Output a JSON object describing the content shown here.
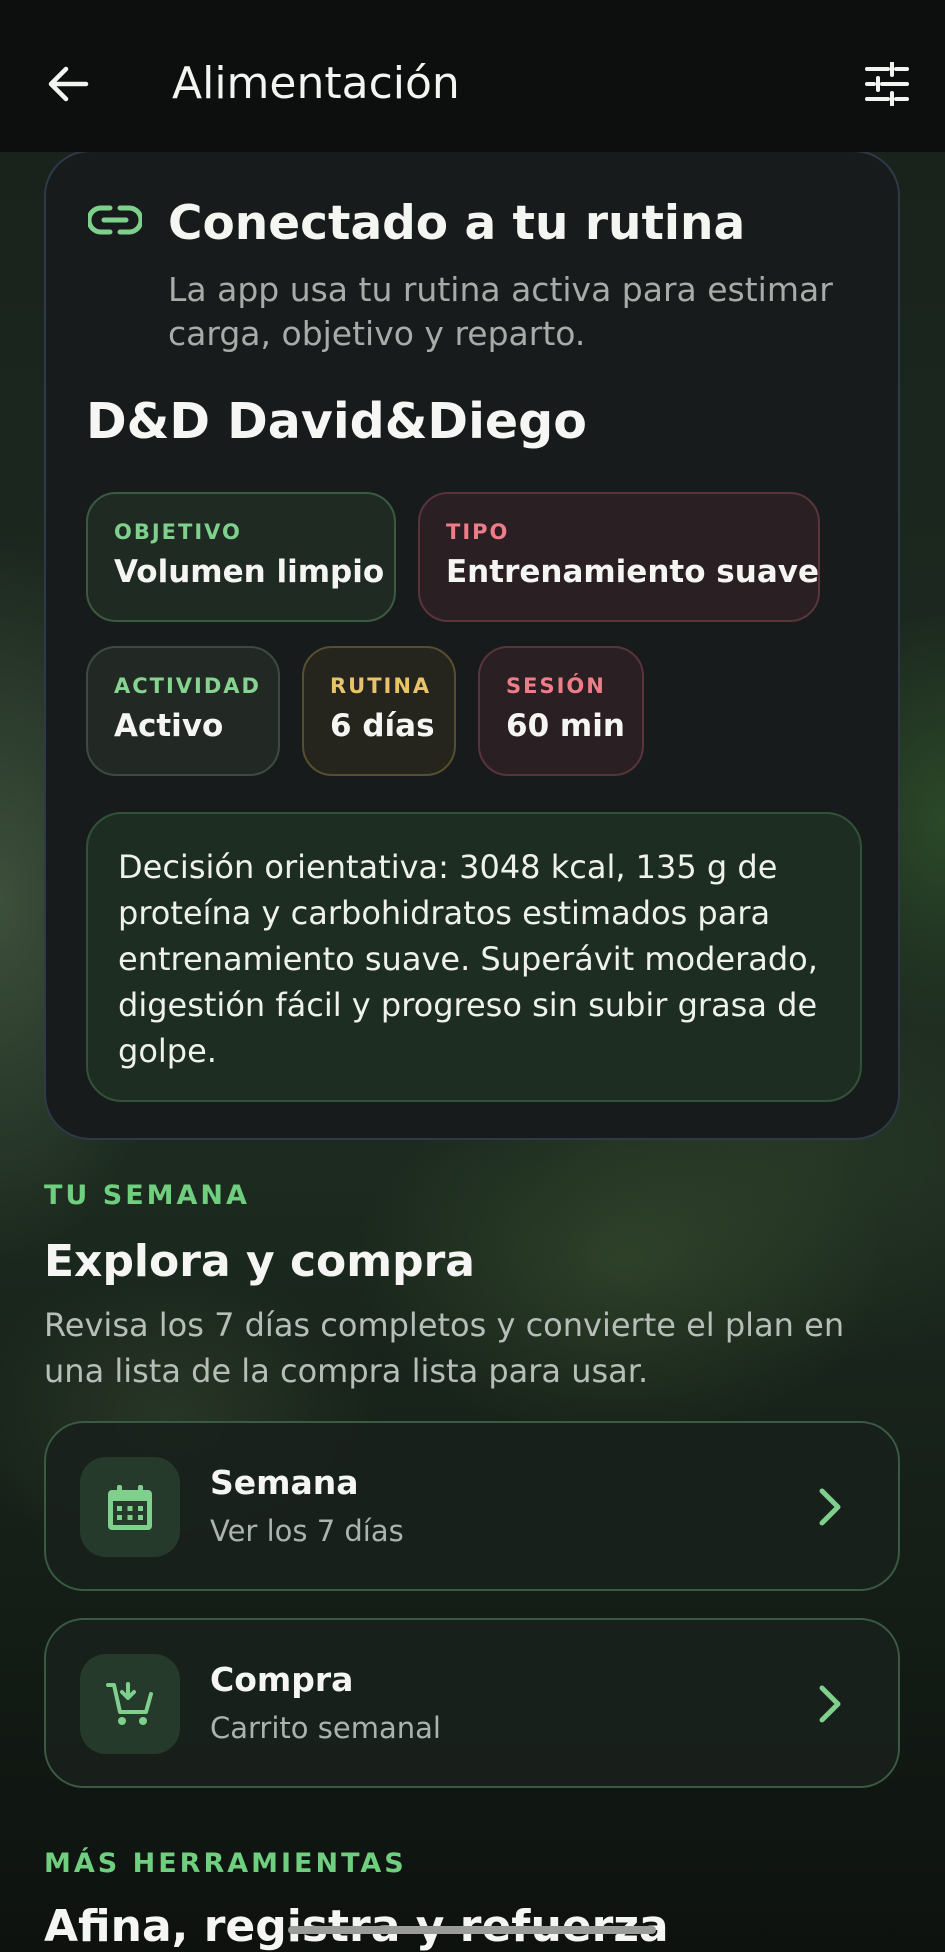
{
  "appbar": {
    "title": "Alimentación",
    "back_icon": "arrow-left-icon",
    "filter_icon": "tune-sliders-icon"
  },
  "routine_card": {
    "icon": "link-icon",
    "title": "Conectado a tu rutina",
    "subtitle": "La app usa tu rutina activa para estimar carga, objetivo y reparto.",
    "routine_name": "D&D David&Diego",
    "chips": [
      {
        "label": "OBJETIVO",
        "value": "Volumen limpio",
        "color": "#7fd08d"
      },
      {
        "label": "TIPO",
        "value": "Entrenamiento suave",
        "color": "#ee7d89"
      },
      {
        "label": "ACTIVIDAD",
        "value": "Activo",
        "color": "#86d48f"
      },
      {
        "label": "RUTINA",
        "value": "6 días",
        "color": "#e8c36a"
      },
      {
        "label": "SESIÓN",
        "value": "60 min",
        "color": "#ee7d89"
      }
    ],
    "decision": "Decisión orientativa: 3048 kcal, 135 g de proteína y carbohidratos estimados para entrenamiento suave. Superávit moderado, digestión fácil y progreso sin subir grasa de golpe."
  },
  "week_section": {
    "eyebrow": "TU SEMANA",
    "title": "Explora y compra",
    "description": "Revisa los 7 días completos y convierte el plan en una lista de la compra lista para usar.",
    "items": [
      {
        "title": "Semana",
        "subtitle": "Ver los 7 días",
        "icon": "calendar-icon"
      },
      {
        "title": "Compra",
        "subtitle": "Carrito semanal",
        "icon": "cart-add-icon"
      }
    ]
  },
  "tools_section": {
    "eyebrow": "MÁS HERRAMIENTAS",
    "title": "Afina, registra y refuerza"
  },
  "colors": {
    "accent_green": "#6fcf7e",
    "appbar_bg": "#0d0f0e",
    "card_bg": "#181b1b"
  }
}
